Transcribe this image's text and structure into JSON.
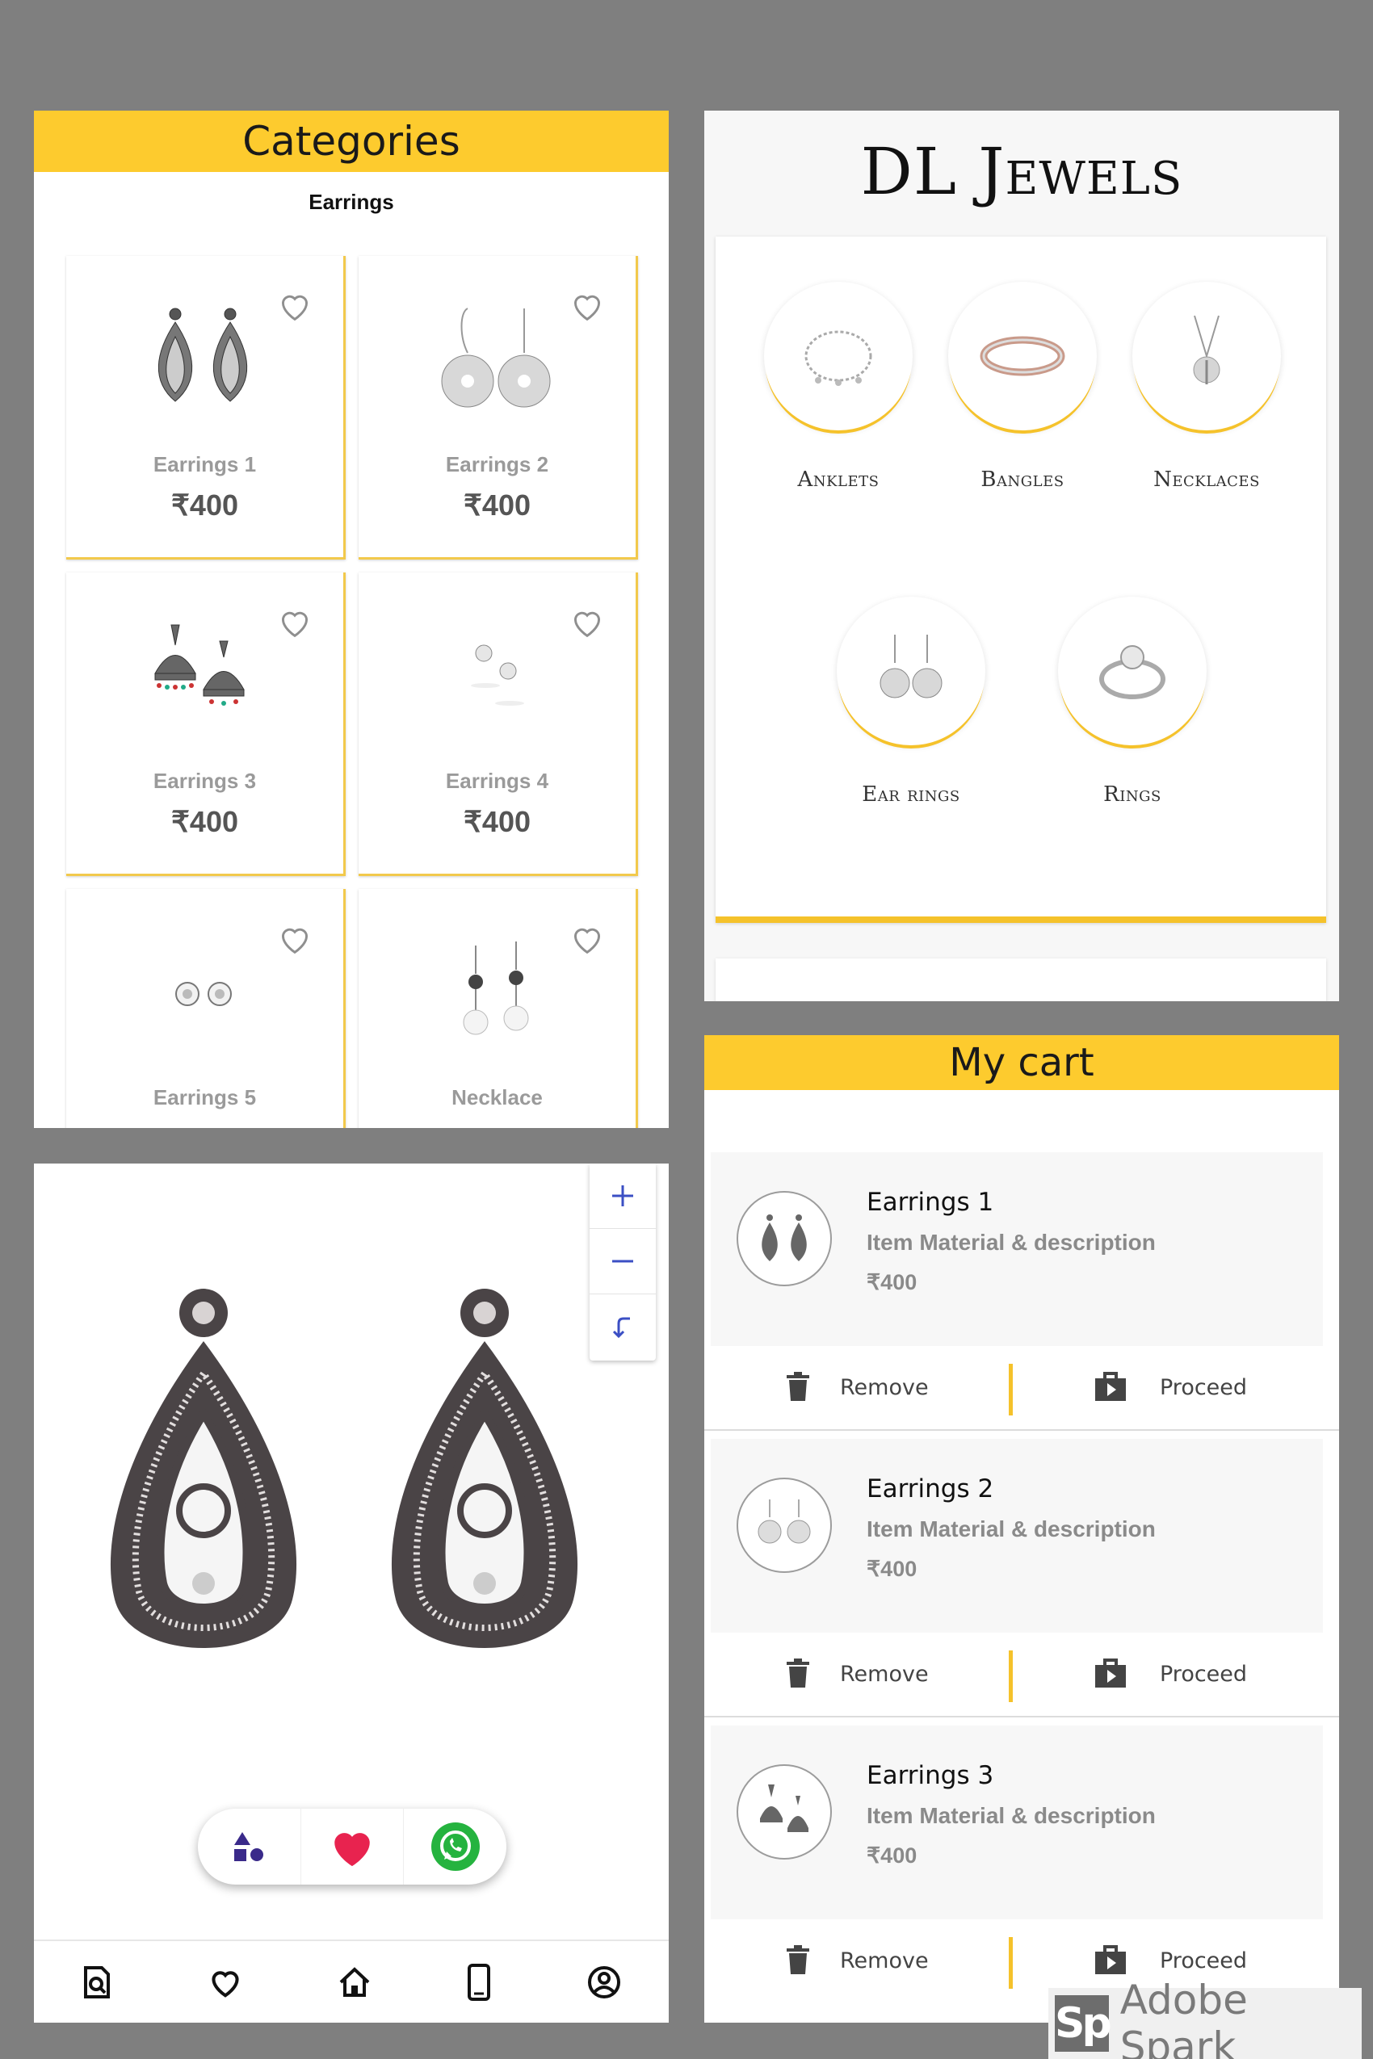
{
  "categories": {
    "title": "Categories",
    "subtitle": "Earrings",
    "items": [
      {
        "name": "Earrings 1",
        "price": "₹400",
        "icon": "teardrop-earrings"
      },
      {
        "name": "Earrings 2",
        "price": "₹400",
        "icon": "flower-earrings"
      },
      {
        "name": "Earrings 3",
        "price": "₹400",
        "icon": "jhumka-earrings"
      },
      {
        "name": "Earrings 4",
        "price": "₹400",
        "icon": "stud-earrings"
      },
      {
        "name": "Earrings 5",
        "price": "",
        "icon": "halo-stud-earrings"
      },
      {
        "name": "Necklace",
        "price": "",
        "icon": "pearl-drop-earrings"
      }
    ]
  },
  "home": {
    "brand": "DL Jewels",
    "categories": [
      {
        "label": "Anklets",
        "icon": "anklet"
      },
      {
        "label": "Bangles",
        "icon": "bangle"
      },
      {
        "label": "Necklaces",
        "icon": "necklace"
      },
      {
        "label": "Ear rings",
        "icon": "earring"
      },
      {
        "label": "Rings",
        "icon": "ring"
      }
    ]
  },
  "product_zoom": {
    "zoom_controls": [
      "zoom-in",
      "zoom-out",
      "reset"
    ],
    "actions": [
      "shapes-icon",
      "heart-icon",
      "whatsapp-icon"
    ],
    "nav": [
      "search-icon",
      "favorites-icon",
      "home-icon",
      "phone-icon",
      "account-icon"
    ]
  },
  "cart": {
    "title": "My cart",
    "items": [
      {
        "title": "Earrings 1",
        "desc": "Item Material & description",
        "price": "₹400"
      },
      {
        "title": "Earrings 2",
        "desc": "Item Material & description",
        "price": "₹400"
      },
      {
        "title": "Earrings 3",
        "desc": "Item Material & description",
        "price": "₹400"
      }
    ],
    "remove_label": "Remove",
    "proceed_label": "Proceed"
  },
  "watermark": {
    "logo": "Sp",
    "text": "Adobe Spark"
  },
  "colors": {
    "accent": "#fdcb2e",
    "background": "#7f7f7f",
    "heart": "#e8234f",
    "whatsapp": "#25b33f",
    "zoom_icon": "#3b4fc4"
  }
}
